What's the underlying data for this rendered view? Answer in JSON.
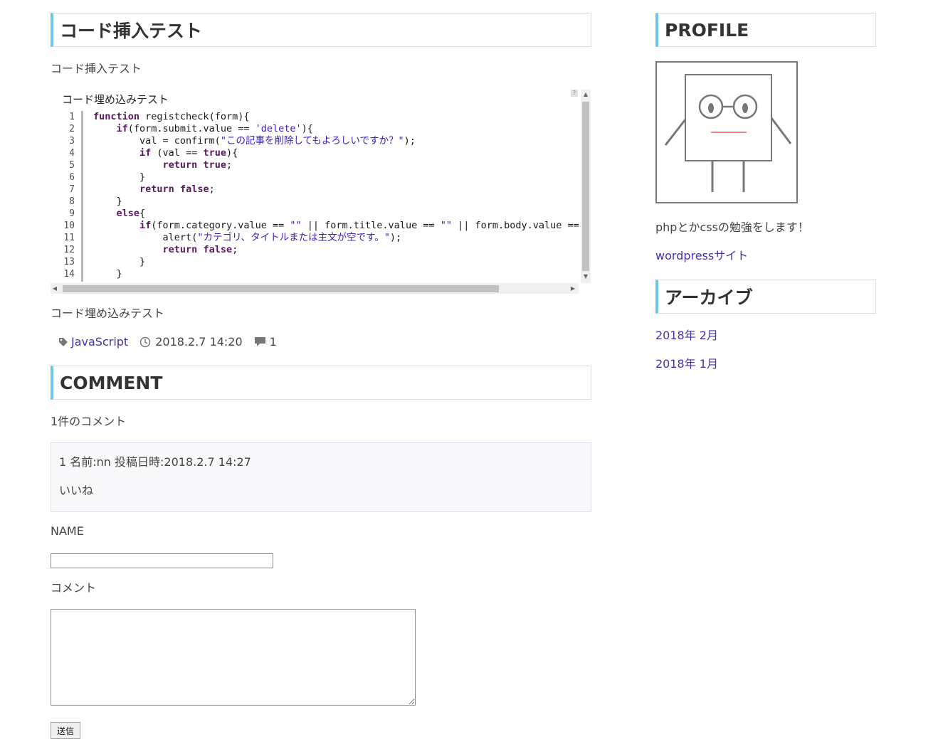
{
  "post": {
    "title": "コード挿入テスト",
    "intro": "コード挿入テスト",
    "after_code": "コード埋め込みテスト",
    "tag": "JavaScript",
    "date": "2018.2.7 14:20",
    "comment_count": "1"
  },
  "code": {
    "title": "コード埋め込みテスト",
    "help": "?",
    "line_numbers": [
      "1",
      "2",
      "3",
      "4",
      "5",
      "6",
      "7",
      "8",
      "9",
      "10",
      "11",
      "12",
      "13",
      "14"
    ],
    "lines": [
      [
        {
          "t": "function",
          "c": "kw"
        },
        {
          "t": " registcheck(form){"
        }
      ],
      [
        {
          "t": "    "
        },
        {
          "t": "if",
          "c": "kw"
        },
        {
          "t": "(form.submit.value == "
        },
        {
          "t": "'delete'",
          "c": "str"
        },
        {
          "t": "){"
        }
      ],
      [
        {
          "t": "        val = confirm("
        },
        {
          "t": "\"この記事を削除してもよろしいですか？\"",
          "c": "str"
        },
        {
          "t": ");"
        }
      ],
      [
        {
          "t": "        "
        },
        {
          "t": "if",
          "c": "kw"
        },
        {
          "t": " (val == "
        },
        {
          "t": "true",
          "c": "kw"
        },
        {
          "t": "){"
        }
      ],
      [
        {
          "t": "            "
        },
        {
          "t": "return",
          "c": "kw"
        },
        {
          "t": " "
        },
        {
          "t": "true",
          "c": "kw"
        },
        {
          "t": ";"
        }
      ],
      [
        {
          "t": "        }"
        }
      ],
      [
        {
          "t": "        "
        },
        {
          "t": "return",
          "c": "kw"
        },
        {
          "t": " "
        },
        {
          "t": "false",
          "c": "kw"
        },
        {
          "t": ";"
        }
      ],
      [
        {
          "t": "    }"
        }
      ],
      [
        {
          "t": "    "
        },
        {
          "t": "else",
          "c": "kw"
        },
        {
          "t": "{"
        }
      ],
      [
        {
          "t": "        "
        },
        {
          "t": "if",
          "c": "kw"
        },
        {
          "t": "(form.category.value == "
        },
        {
          "t": "\"\"",
          "c": "str"
        },
        {
          "t": " || form.title.value == "
        },
        {
          "t": "\"\"",
          "c": "str"
        },
        {
          "t": " || form.body.value == "
        },
        {
          "t": "\"\"",
          "c": "str"
        },
        {
          "t": "){"
        }
      ],
      [
        {
          "t": "            alert("
        },
        {
          "t": "\"カテゴリ、タイトルまたは主文が空です。\"",
          "c": "str"
        },
        {
          "t": ");"
        }
      ],
      [
        {
          "t": "            "
        },
        {
          "t": "return",
          "c": "kw"
        },
        {
          "t": " "
        },
        {
          "t": "false",
          "c": "kw"
        },
        {
          "t": ";"
        }
      ],
      [
        {
          "t": "        }"
        }
      ],
      [
        {
          "t": "    }"
        }
      ]
    ]
  },
  "comments": {
    "heading": "COMMENT",
    "count_text": "1件のコメント",
    "items": [
      {
        "header": "1 名前:nn 投稿日時:2018.2.7 14:27",
        "body": "いいね"
      }
    ]
  },
  "form": {
    "name_label": "NAME",
    "name_value": "",
    "comment_label": "コメント",
    "comment_value": "",
    "submit_label": "送信"
  },
  "sidebar": {
    "profile_heading": "PROFILE",
    "profile_text": "phpとかcssの勉強をします！",
    "profile_link": "wordpressサイト",
    "archive_heading": "アーカイブ",
    "archives": [
      "2018年 2月",
      "2018年 1月"
    ]
  },
  "colors": {
    "heading_accent": "#6ec6ee",
    "link": "#4433aa",
    "keyword": "#5a1860",
    "string": "#3322bb"
  }
}
